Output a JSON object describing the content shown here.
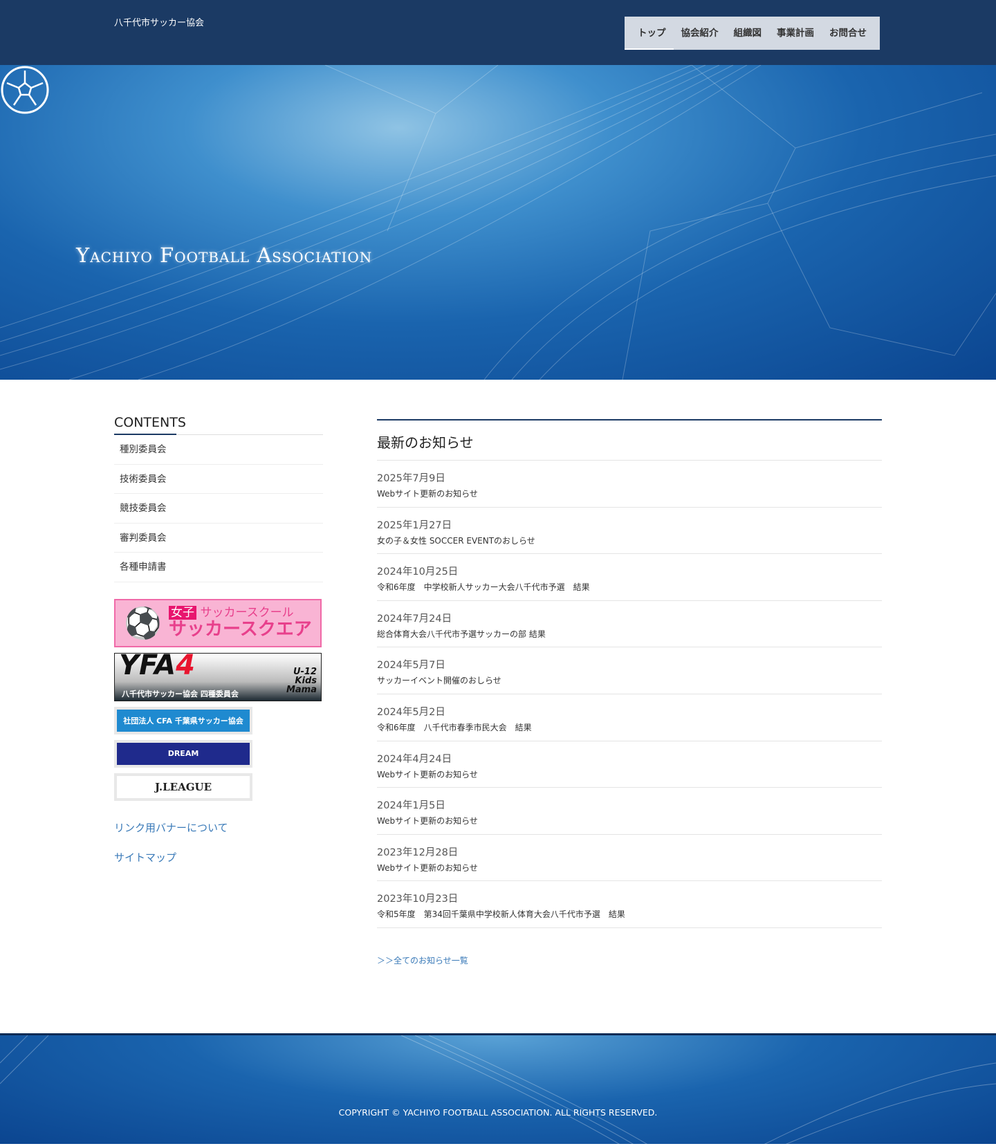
{
  "header": {
    "site_name": "八千代市サッカー協会",
    "nav": [
      {
        "label": "トップ"
      },
      {
        "label": "協会紹介"
      },
      {
        "label": "組織図"
      },
      {
        "label": "事業計画"
      },
      {
        "label": "お問合せ"
      }
    ]
  },
  "hero": {
    "logo_text": "Yachiyo Football Association"
  },
  "sidebar": {
    "title": "CONTENTS",
    "items": [
      {
        "label": "種別委員会"
      },
      {
        "label": "技術委員会"
      },
      {
        "label": "競技委員会"
      },
      {
        "label": "審判委員会"
      },
      {
        "label": "各種申請書"
      }
    ],
    "banners": {
      "pink_tag": "女子",
      "pink_line1": "サッカースクール",
      "pink_line2": "サッカースクエア",
      "yfa_main": "YFA",
      "yfa_num": "4",
      "yfa_sub": "八千代市サッカー協会 四種委員会",
      "yfa_side": "U-12 Kids Mama",
      "cfa": "社団法人 CFA 千葉県サッカー協会",
      "dream": "DREAM",
      "jleague": "J.LEAGUE"
    },
    "links": [
      {
        "label": "リンク用バナーについて"
      },
      {
        "label": "サイトマップ"
      }
    ]
  },
  "main": {
    "title": "最新のお知らせ",
    "news": [
      {
        "date": "2025年7月9日",
        "title": "Webサイト更新のお知らせ"
      },
      {
        "date": "2025年1月27日",
        "title": "女の子＆女性 SOCCER EVENTのおしらせ"
      },
      {
        "date": "2024年10月25日",
        "title": "令和6年度　中学校新人サッカー大会八千代市予選　結果"
      },
      {
        "date": "2024年7月24日",
        "title": "総合体育大会八千代市予選サッカーの部 結果"
      },
      {
        "date": "2024年5月7日",
        "title": "サッカーイベント開催のおしらせ"
      },
      {
        "date": "2024年5月2日",
        "title": "令和6年度　八千代市春季市民大会　結果"
      },
      {
        "date": "2024年4月24日",
        "title": "Webサイト更新のお知らせ"
      },
      {
        "date": "2024年1月5日",
        "title": "Webサイト更新のお知らせ"
      },
      {
        "date": "2023年12月28日",
        "title": "Webサイト更新のお知らせ"
      },
      {
        "date": "2023年10月23日",
        "title": "令和5年度　第34回千葉県中学校新人体育大会八千代市予選　結果"
      }
    ],
    "all_link": "＞＞全てのお知らせ一覧"
  },
  "footer": {
    "copyright": "COPYRIGHT © YACHIYO FOOTBALL ASSOCIATION. ALL RIGHTS RESERVED."
  }
}
